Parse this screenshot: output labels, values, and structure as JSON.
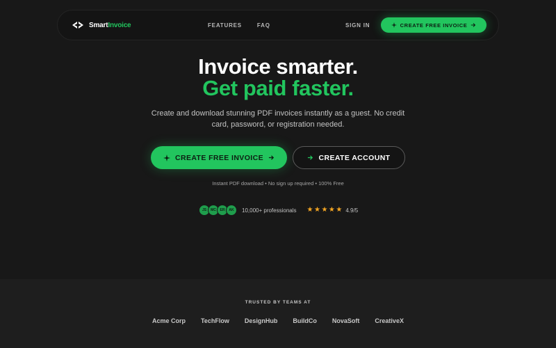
{
  "nav": {
    "brand": {
      "part1": "Smart",
      "part2": "Invoice"
    },
    "links": [
      "FEATURES",
      "FAQ"
    ],
    "sign_in": "SIGN IN",
    "cta": "CREATE FREE INVOICE"
  },
  "hero": {
    "title_line1": "Invoice smarter.",
    "title_line2": "Get paid faster.",
    "subtitle": "Create and download stunning PDF invoices instantly as a guest. No credit card, password, or registration needed.",
    "primary_button": "CREATE FREE INVOICE",
    "secondary_button": "CREATE ACCOUNT",
    "features_line": "Instant PDF download • No sign up required • 100% Free"
  },
  "social_proof": {
    "avatars": [
      "JS",
      "MC",
      "ER",
      "AK"
    ],
    "professionals": "10,000+ professionals",
    "stars": 5,
    "rating": "4.9/5"
  },
  "trusted": {
    "title": "TRUSTED BY TEAMS AT",
    "companies": [
      "Acme Corp",
      "TechFlow",
      "DesignHub",
      "BuildCo",
      "NovaSoft",
      "CreativeX"
    ]
  },
  "colors": {
    "background": "#181818",
    "accent": "#22c55e",
    "star": "#f5a623"
  }
}
